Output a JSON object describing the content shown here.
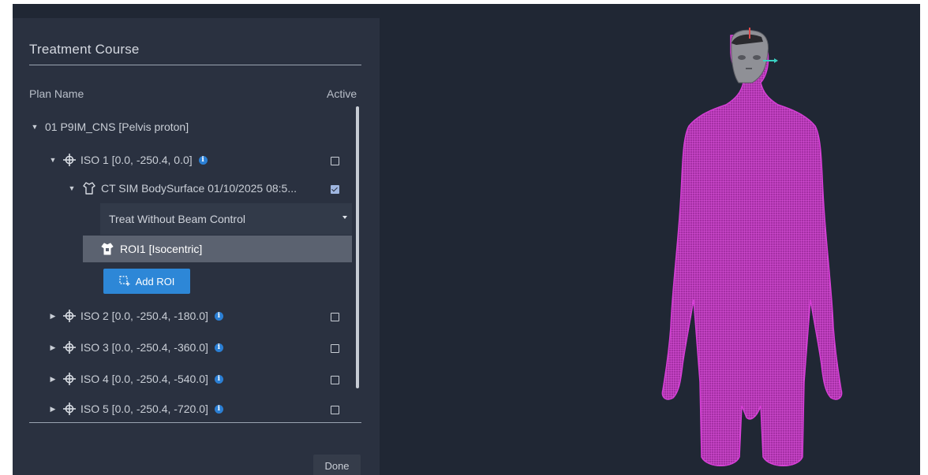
{
  "panel": {
    "title": "Treatment Course",
    "col_plan": "Plan Name",
    "col_active": "Active",
    "plan": {
      "label": "01 P9IM_CNS [Pelvis proton]"
    },
    "isos": [
      {
        "label": "ISO 1 [0.0, -250.4, 0.0]",
        "expanded": true,
        "active": false
      },
      {
        "label": "ISO 2 [0.0, -250.4, -180.0]",
        "expanded": false,
        "active": false
      },
      {
        "label": "ISO 3 [0.0, -250.4, -360.0]",
        "expanded": false,
        "active": false
      },
      {
        "label": "ISO 4 [0.0, -250.4, -540.0]",
        "expanded": false,
        "active": false
      },
      {
        "label": "ISO 5 [0.0, -250.4, -720.0]",
        "expanded": false,
        "active": false
      }
    ],
    "surface": {
      "label": "CT SIM BodySurface 01/10/2025 08:5...",
      "active": true
    },
    "beam_mode": {
      "selected": "Treat Without Beam Control"
    },
    "roi": {
      "label": "ROI1 [Isocentric]"
    },
    "add_roi_label": "Add ROI",
    "done_label": "Done",
    "info_glyph": "i"
  },
  "colors": {
    "background": "#202734",
    "panel": "#2a3140",
    "accent": "#2d87d7",
    "mesh": "#d63fd6"
  },
  "icons": [
    "chevron-down-icon",
    "chevron-right-icon",
    "crosshair-icon",
    "info-icon",
    "body-surface-icon",
    "roi-icon",
    "add-roi-icon",
    "checkbox-icon"
  ]
}
